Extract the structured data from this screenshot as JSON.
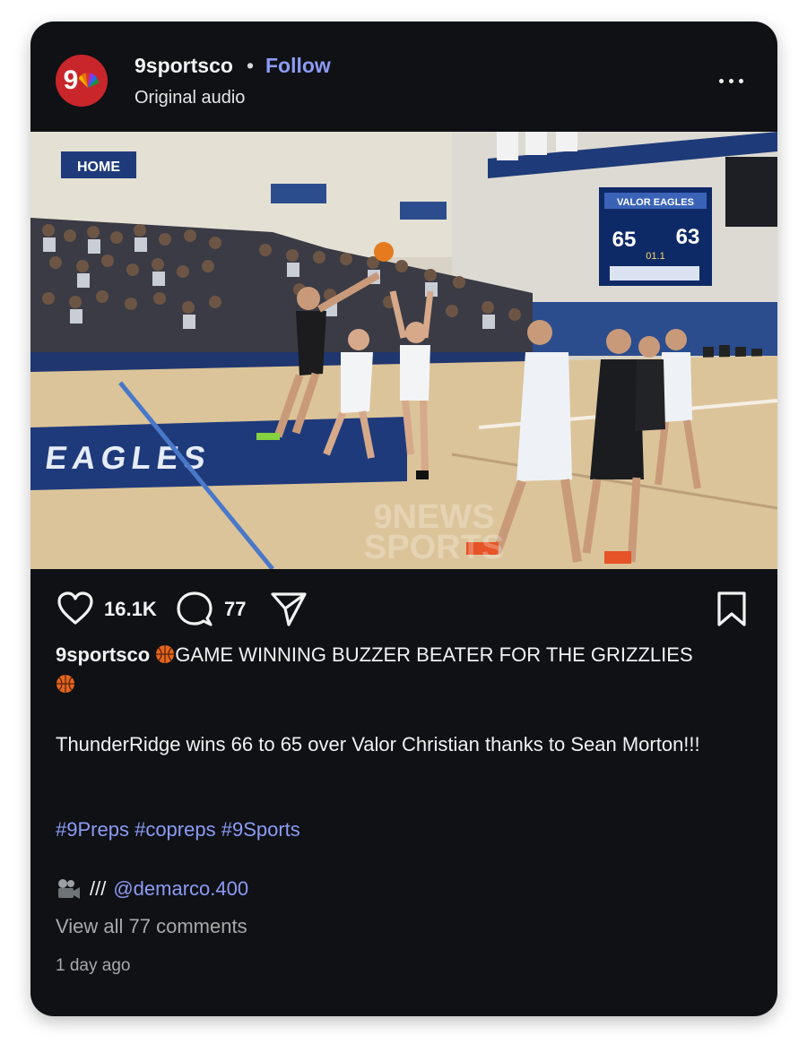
{
  "post": {
    "username": "9sportsco",
    "separator": "•",
    "follow_label": "Follow",
    "audio": "Original audio",
    "avatar_text": "9",
    "more_icon": "more-horizontal-icon"
  },
  "video": {
    "home_banner": "HOME",
    "scoreboard": {
      "title": "VALOR EAGLES",
      "home_score": "65",
      "away_score": "63",
      "clock": "01.1"
    },
    "floor_text": "EAGLES",
    "watermark_line1": "9NEWS",
    "watermark_line2": "SPORTS"
  },
  "actions": {
    "like_icon": "heart-icon",
    "likes": "16.1K",
    "comment_icon": "comment-icon",
    "comments": "77",
    "share_icon": "send-icon",
    "save_icon": "bookmark-icon"
  },
  "caption": {
    "username": "9sportsco",
    "headline": "GAME WINNING BUZZER BEATER FOR THE GRIZZLIES",
    "emoji_icon": "basketball-icon",
    "body": "ThunderRidge wins 66 to 65 over Valor Christian thanks to Sean Morton!!!",
    "hashtags": [
      "#9Preps",
      "#copreps",
      "#9Sports"
    ],
    "credit_icon": "movie-camera-icon",
    "credit_prefix": "///",
    "credit_mention": "@demarco.400"
  },
  "footer": {
    "view_all": "View all 77 comments",
    "timestamp": "1 day ago"
  },
  "colors": {
    "background": "#0f1115",
    "link": "#8c9bf5",
    "avatar": "#c8262b",
    "muted": "#a9a9a9"
  }
}
